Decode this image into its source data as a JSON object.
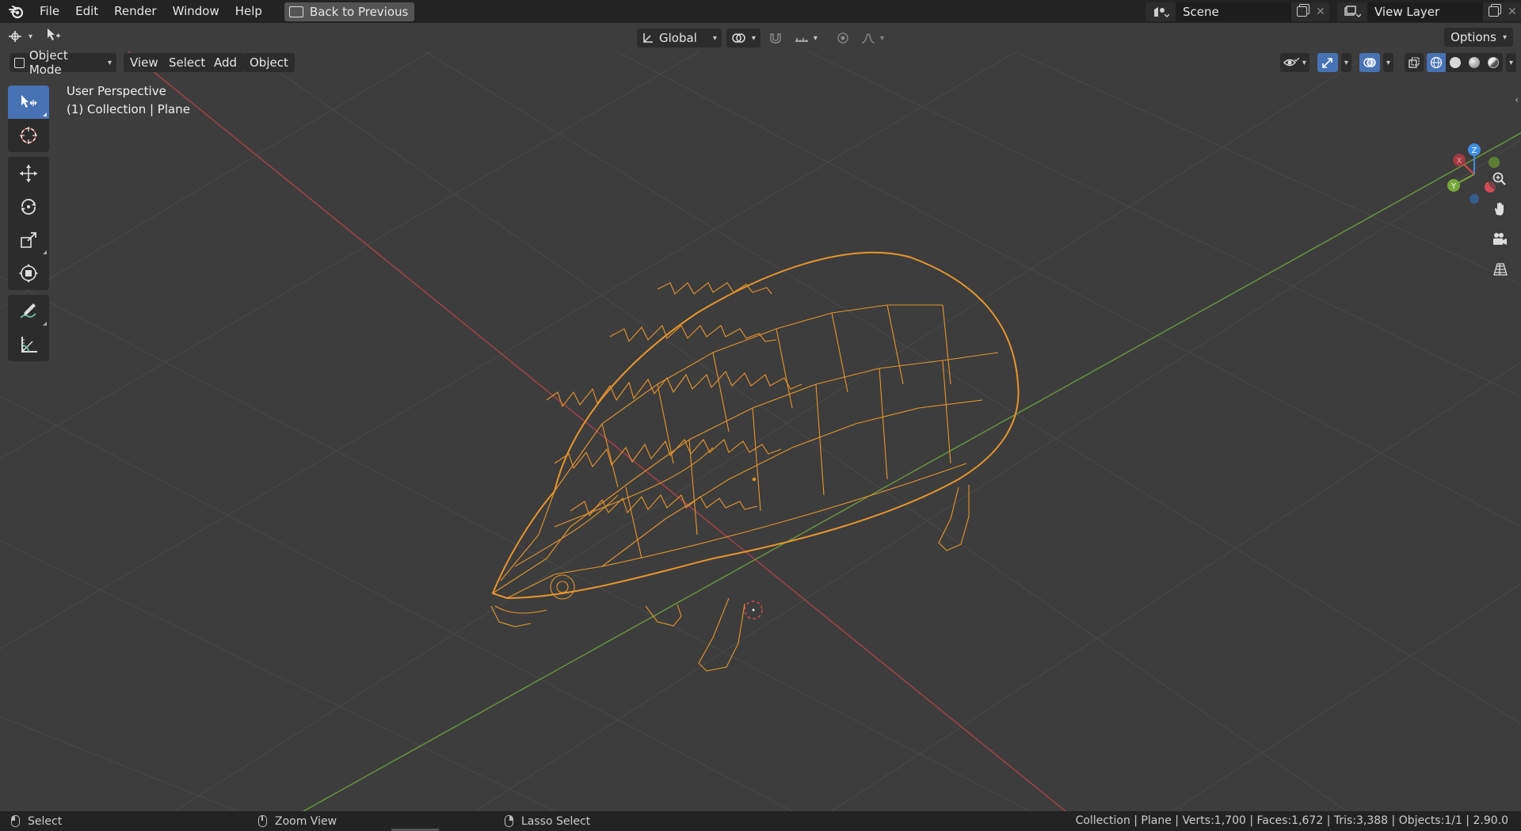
{
  "app": {
    "name": "Blender",
    "version": "2.90.0"
  },
  "menu": {
    "items": [
      "File",
      "Edit",
      "Render",
      "Window",
      "Help"
    ],
    "back_label": "Back to Previous"
  },
  "scene": {
    "name": "Scene",
    "view_layer": "View Layer"
  },
  "tool_header": {
    "orientation": "Global",
    "options_label": "Options"
  },
  "viewport_header": {
    "mode": "Object Mode",
    "menus": [
      "View",
      "Select",
      "Add",
      "Object"
    ]
  },
  "viewport": {
    "perspective": "User Perspective",
    "collection_info": "(1) Collection | Plane",
    "axis_labels": {
      "x": "X",
      "y": "Y",
      "z": "Z"
    }
  },
  "toolbar": {
    "tools": [
      "select-box",
      "cursor",
      "move",
      "rotate",
      "scale",
      "transform",
      "annotate",
      "measure"
    ],
    "active": "select-box"
  },
  "statusbar": {
    "left_action": "Select",
    "middle_action": "Zoom View",
    "right_action": "Lasso Select",
    "stats": "Collection | Plane | Verts:1,700 | Faces:1,672 | Tris:3,388 | Objects:1/1 | 2.90.0"
  },
  "colors": {
    "accent": "#4772b3",
    "selection_wire": "#e8952c",
    "x_axis": "#d44a56",
    "y_axis": "#75a73b",
    "z_axis": "#3d8ee0",
    "background": "#3d3d3d"
  }
}
